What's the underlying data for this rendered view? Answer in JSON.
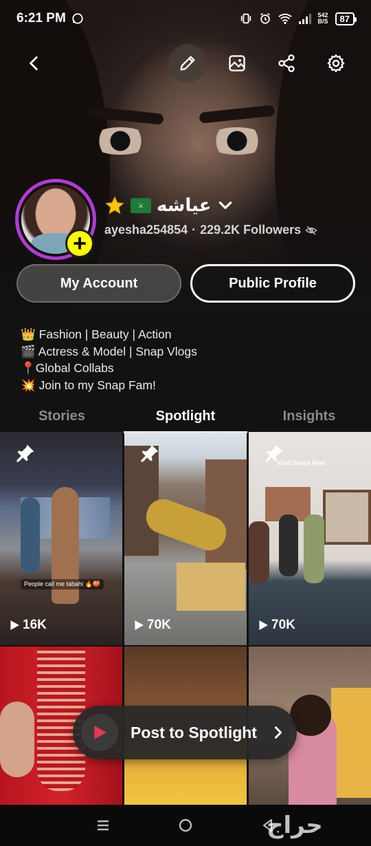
{
  "status_bar": {
    "time": "6:21 PM",
    "net_speed_value": "542",
    "net_speed_unit": "B/S",
    "battery": "87"
  },
  "profile": {
    "display_name": "عياشه",
    "username": "ayesha254854",
    "separator": "·",
    "followers": "229.2K Followers"
  },
  "buttons": {
    "my_account": "My Account",
    "public_profile": "Public Profile"
  },
  "bio": [
    "👑 Fashion | Beauty | Action",
    "🎬 Actress & Model | Snap Vlogs",
    "📍Global Collabs",
    "💥 Join to my Snap Fam!"
  ],
  "tabs": [
    "Stories",
    "Spotlight",
    "Insights"
  ],
  "active_tab": "Spotlight",
  "tiles": [
    {
      "views": "16K",
      "caption": "People call me tabahi 🔥🍑",
      "pinned": true
    },
    {
      "views": "70K",
      "caption": "",
      "pinned": true
    },
    {
      "views": "70K",
      "caption": "Viral Dance Reel",
      "pinned": true
    },
    {
      "views": "",
      "caption": "",
      "pinned": false
    },
    {
      "views": "",
      "caption": "",
      "pinned": false
    },
    {
      "views": "",
      "caption": "",
      "pinned": false
    }
  ],
  "cta": {
    "label": "Post to Spotlight"
  },
  "watermark": "حراج",
  "icons": {
    "back": "chevron-left-icon",
    "edit": "pencil-icon",
    "background": "image-icon",
    "share": "share-icon",
    "settings": "gear-icon",
    "followers_hidden": "eye-off-icon",
    "name_dropdown": "chevron-down-icon",
    "badge": "star-icon",
    "flag": "saudi-flag-icon"
  },
  "colors": {
    "ring": "#b33ad6",
    "add_button": "#fffc00",
    "cta_play": "#e8364f",
    "background": "#121212"
  }
}
